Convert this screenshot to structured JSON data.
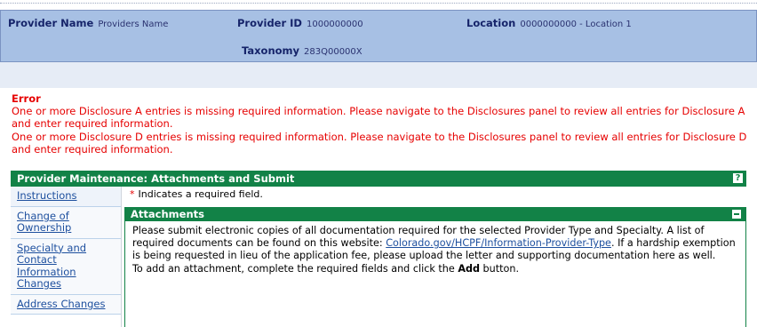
{
  "provider": {
    "name_label": "Provider Name",
    "name_value": "Providers Name",
    "id_label": "Provider ID",
    "id_value": "1000000000",
    "location_label": "Location",
    "location_value": "0000000000 - Location 1",
    "taxonomy_label": "Taxonomy",
    "taxonomy_value": "283Q00000X"
  },
  "error": {
    "title": "Error",
    "lines": [
      "One or more Disclosure A entries is missing required information. Please navigate to the Disclosures panel to review all entries for Disclosure A and enter required information.",
      "One or more Disclosure D entries is missing required information. Please navigate to the Disclosures panel to review all entries for Disclosure D and enter required information."
    ]
  },
  "panel": {
    "title": "Provider Maintenance: Attachments and Submit",
    "help": "?"
  },
  "sidebar": {
    "items": [
      {
        "label": "Instructions"
      },
      {
        "label": "Change of Ownership"
      },
      {
        "label": "Specialty and Contact Information Changes"
      },
      {
        "label": "Address Changes"
      }
    ]
  },
  "required_note": {
    "star": "*",
    "text": "Indicates a required field."
  },
  "attachments": {
    "title": "Attachments",
    "intro_a": "Please submit electronic copies of all documentation required for the selected Provider Type and Specialty. A list of required documents can be found on this website: ",
    "link": "Colorado.gov/HCPF/Information-Provider-Type",
    "intro_b": ". If a hardship exemption is being requested in lieu of the application fee, please upload the letter and supporting documentation here as well.",
    "instr_a": "To add an attachment, complete the required fields and click the ",
    "instr_bold": "Add",
    "instr_b": " button."
  },
  "colors": {
    "header_bg": "#a7c0e4",
    "panel_green": "#128247",
    "error_red": "#e60000",
    "link_blue": "#1d4f9e"
  }
}
